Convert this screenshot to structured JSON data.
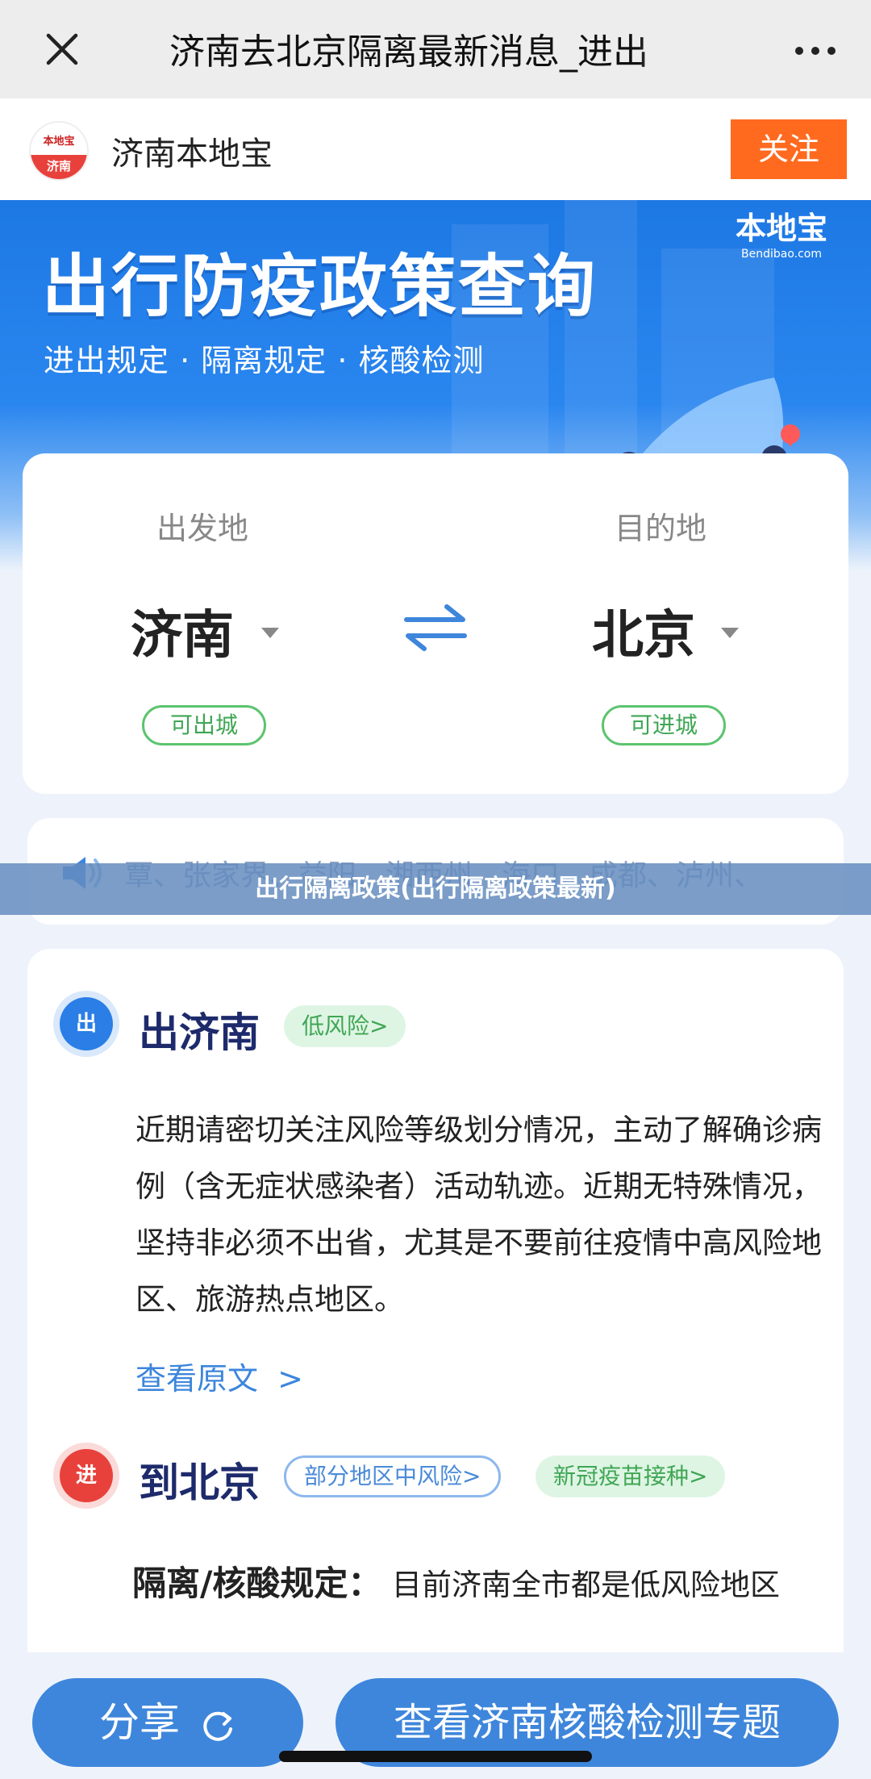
{
  "nav": {
    "title": "济南去北京隔离最新消息_进出",
    "close_icon": "close-icon",
    "more_icon": "more-icon"
  },
  "account": {
    "logo_top": "本地宝",
    "logo_bottom": "济南",
    "name": "济南本地宝",
    "follow_label": "关注"
  },
  "banner": {
    "title": "出行防疫政策查询",
    "subtitle": "进出规定 · 隔离规定 · 核酸检测",
    "brand": "本地宝",
    "brand_url": "Bendibao.com"
  },
  "route": {
    "from_label": "出发地",
    "to_label": "目的地",
    "from_city": "济南",
    "to_city": "北京",
    "from_status": "可出城",
    "to_status": "可进城"
  },
  "ticker": {
    "text": "覃、张家界、益阳、湘西州、海口、成都、泸州、"
  },
  "overlay": {
    "caption": "出行隔离政策(出行隔离政策最新)"
  },
  "out_section": {
    "badge": "出",
    "title": "出济南",
    "risk_tag": "低风险>",
    "body": "近期请密切关注风险等级划分情况，主动了解确诊病例（含无症状感染者）活动轨迹。近期无特殊情况，坚持非必须不出省，尤其是不要前往疫情中高风险地区、旅游热点地区。",
    "link": "查看原文",
    "link_chevron": ">"
  },
  "in_section": {
    "badge": "进",
    "title": "到北京",
    "risk_tag": "部分地区中风险>",
    "vaccine_tag": "新冠疫苗接种>",
    "rule_label": "隔离/核酸规定：",
    "rule_value": "目前济南全市都是低风险地区"
  },
  "bottom": {
    "share_label": "分享",
    "topic_label": "查看济南核酸检测专题"
  },
  "colors": {
    "accent_blue": "#3e86db",
    "follow_orange": "#ff6a1f",
    "green": "#3fa654",
    "red": "#e8413b"
  }
}
